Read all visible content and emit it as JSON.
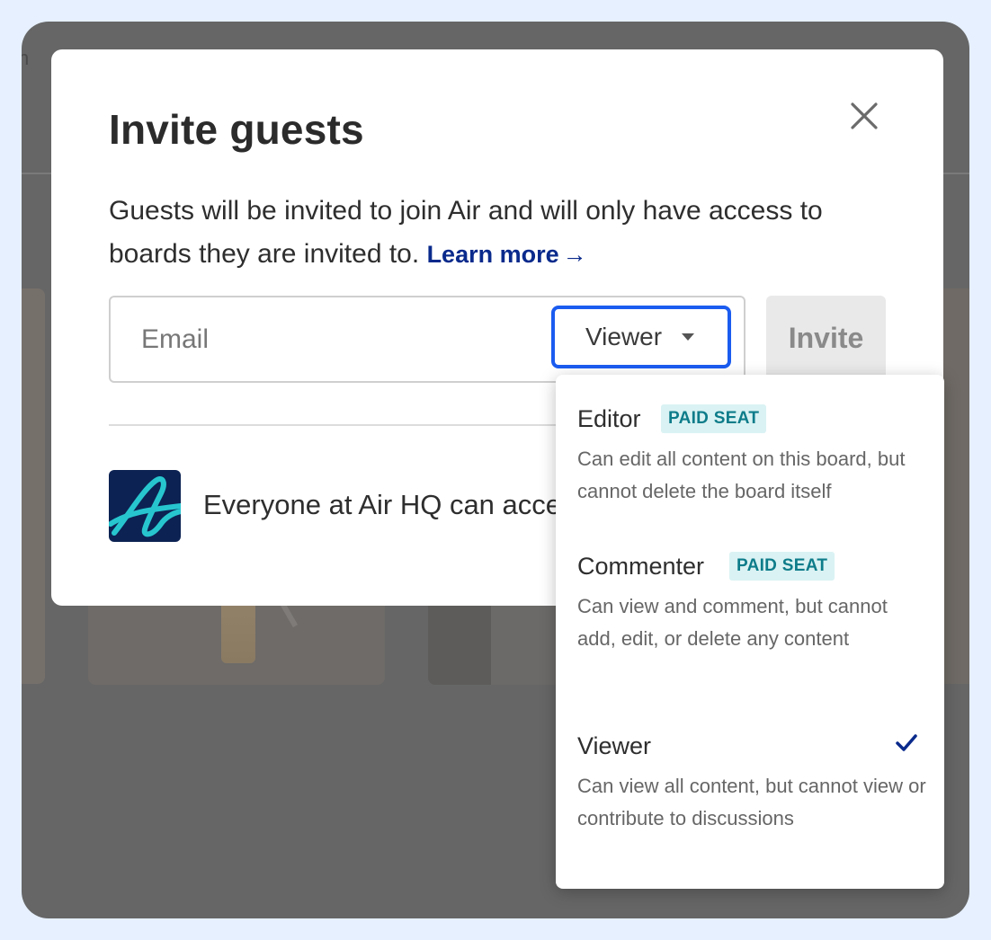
{
  "background": {
    "header_glyph": "n"
  },
  "modal": {
    "title": "Invite guests",
    "description": "Guests will be invited to join Air and will only have access to boards they are invited to.",
    "learn_more": "Learn more",
    "learn_more_arrow": "→",
    "email_placeholder": "Email",
    "role_selected": "Viewer",
    "invite_label": "Invite",
    "workspace_text": "Everyone at Air HQ can access"
  },
  "dropdown": {
    "options": [
      {
        "title": "Editor",
        "badge": "PAID SEAT",
        "description": "Can edit all content on this board, but cannot delete the board itself",
        "selected": false
      },
      {
        "title": "Commenter",
        "badge": "PAID SEAT",
        "description": "Can view and comment, but cannot add, edit, or delete any content",
        "selected": false
      },
      {
        "title": "Viewer",
        "badge": "",
        "description": "Can view all content, but cannot view or contribute to discussions",
        "selected": true
      }
    ]
  },
  "colors": {
    "accent_blue": "#1b5cf0",
    "link": "#0a2a8c",
    "badge_bg": "#daf2f3",
    "badge_text": "#0e7c8a",
    "logo_bg": "#0c2252",
    "logo_stroke": "#27c6cf"
  },
  "icons": {
    "close": "close-icon",
    "caret": "caret-down-icon",
    "check": "check-icon",
    "logo": "air-logo-icon"
  }
}
